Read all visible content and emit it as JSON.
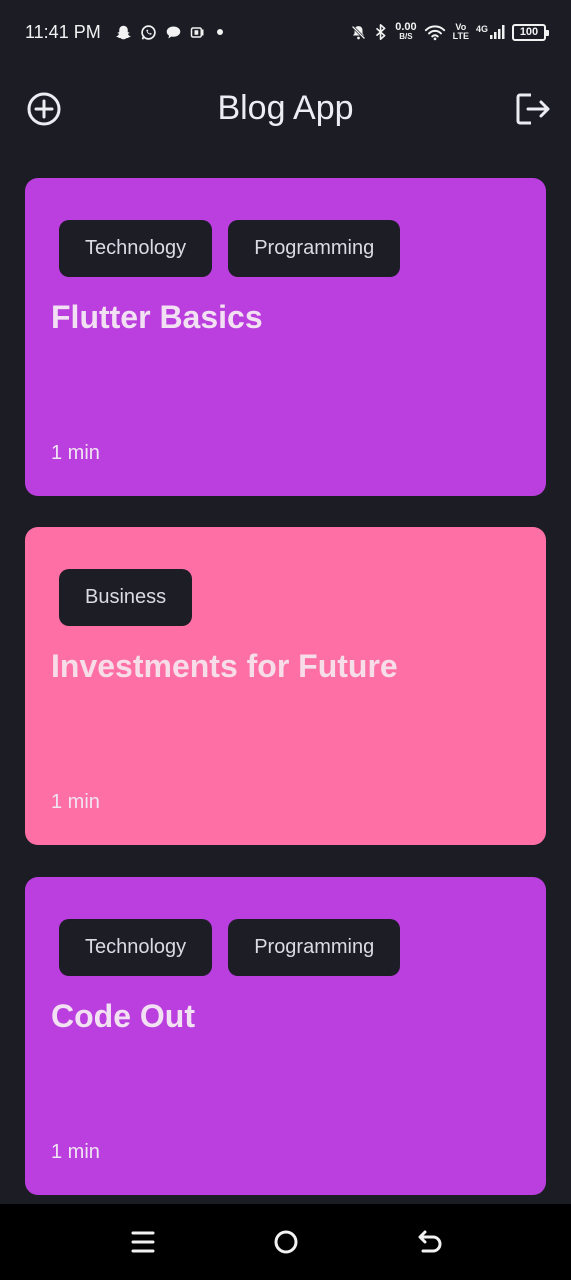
{
  "status_bar": {
    "time": "11:41 PM",
    "net_speed_value": "0.00",
    "net_speed_unit": "B/S",
    "volte_top": "Vo",
    "volte_bottom": "LTE",
    "network": "4G",
    "battery": "100",
    "icons": [
      "snapchat-icon",
      "whatsapp-icon",
      "chat-icon",
      "sim-icon",
      "dot-icon",
      "bell-muted-icon",
      "bluetooth-icon",
      "wifi-icon",
      "signal-icon",
      "battery-icon"
    ]
  },
  "app_bar": {
    "title": "Blog App",
    "left_icon": "add-circle-icon",
    "right_icon": "logout-icon"
  },
  "posts": [
    {
      "tags": [
        "Technology",
        "Programming"
      ],
      "title": "Flutter Basics",
      "read_time": "1 min",
      "color": "#bb3fde"
    },
    {
      "tags": [
        "Business"
      ],
      "title": "Investments for Future",
      "read_time": "1 min",
      "color": "#fe6fa6"
    },
    {
      "tags": [
        "Technology",
        "Programming"
      ],
      "title": "Code Out",
      "read_time": "1 min",
      "color": "#bb3fde"
    }
  ],
  "nav_bar": {
    "icons": [
      "menu-icon",
      "home-icon",
      "back-icon"
    ]
  },
  "colors": {
    "background": "#1b1c24",
    "tag_background": "#1c1d25",
    "purple_card": "#bb3fde",
    "pink_card": "#fe6fa6"
  }
}
